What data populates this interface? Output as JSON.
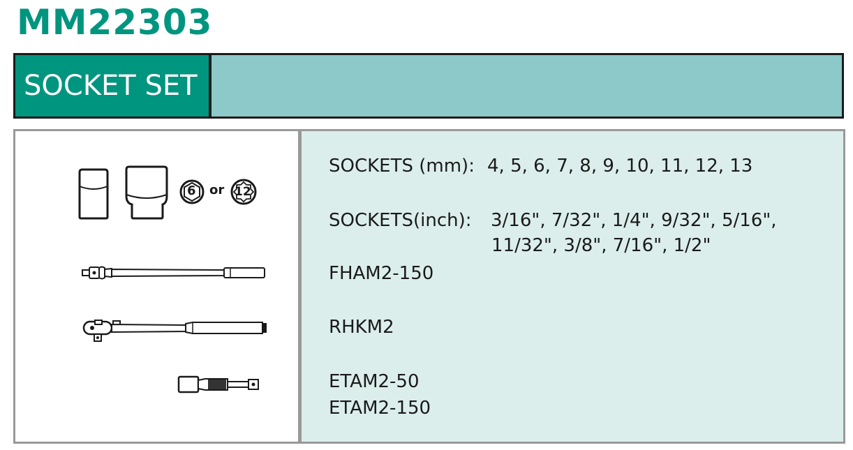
{
  "product_code": "MM22303",
  "title": "SOCKET SET",
  "sizes_mm": {
    "label": "SOCKETS (mm):",
    "values": "4, 5, 6, 7, 8, 9, 10, 11, 12, 13"
  },
  "sizes_inch": {
    "label": "SOCKETS(inch):",
    "line1": "3/16\", 7/32\", 1/4\", 9/32\", 5/16\",",
    "line2": "11/32\", 3/8\", 7/16\", 1/2\""
  },
  "socket_type_options": {
    "hex": "6",
    "or": "or",
    "bihex": "12"
  },
  "items": [
    "FHAM2-150",
    "RHKM2",
    "ETAM2-50",
    "ETAM2-150"
  ],
  "colors": {
    "brand": "#00957f",
    "bar": "#8cc9c8",
    "panel": "#dbeeec",
    "border": "#999999"
  },
  "icons": [
    "short-socket-icon",
    "deep-socket-icon",
    "hex-6-point-icon",
    "bihex-12-point-icon",
    "flex-handle-icon",
    "ratchet-handle-icon",
    "extension-bar-icon"
  ]
}
